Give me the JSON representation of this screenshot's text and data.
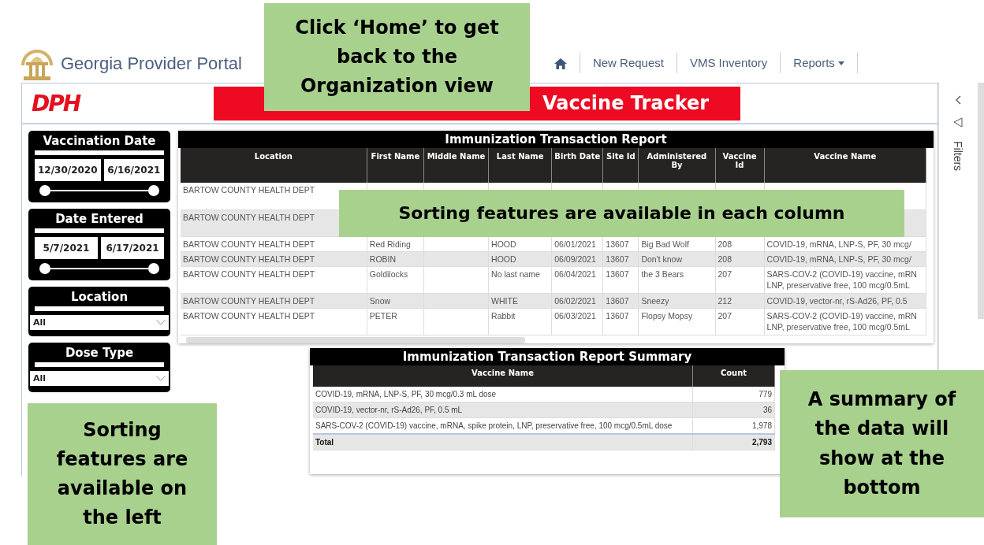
{
  "header": {
    "title": "Georgia Provider Portal",
    "nav": [
      {
        "kind": "home"
      },
      {
        "kind": "link",
        "label": "New Request"
      },
      {
        "kind": "link",
        "label": "VMS Inventory"
      },
      {
        "kind": "dropdown",
        "label": "Reports"
      }
    ]
  },
  "report": {
    "logo": "DPH",
    "banner_title": "Vaccine Tracker",
    "slicers": [
      {
        "kind": "date_range",
        "title": "Vaccination Date",
        "start": "12/30/2020",
        "end": "6/16/2021",
        "handles": [
          {
            "level": 0
          },
          {
            "level": 1
          }
        ]
      },
      {
        "kind": "date_range",
        "title": "Date Entered",
        "start": "5/7/2021",
        "end": "6/17/2021",
        "handles": [
          {
            "level": 0
          },
          {
            "level": 1
          }
        ]
      },
      {
        "kind": "dropdown",
        "title": "Location",
        "value": "All"
      },
      {
        "kind": "dropdown",
        "title": "Dose Type",
        "value": "All"
      }
    ],
    "table": {
      "title": "Immunization Transaction Report",
      "columns": [
        "Location",
        "First Name",
        "Middle Name",
        "Last Name",
        "Birth Date",
        "Site Id",
        "Administered By",
        "Vaccine Id",
        "Vaccine Name"
      ],
      "rows": [
        {
          "cells": [
            "BARTOW COUNTY HEALTH DEPT",
            null,
            null,
            null,
            null,
            null,
            null,
            null,
            null
          ]
        },
        {
          "cells": [
            "BARTOW COUNTY HEALTH DEPT",
            null,
            null,
            null,
            null,
            null,
            null,
            null,
            null
          ]
        },
        {
          "cells": [
            "BARTOW COUNTY HEALTH DEPT",
            "Red Riding",
            null,
            "HOOD",
            "06/01/2021",
            "13607",
            "Big Bad Wolf",
            "208",
            "COVID-19, mRNA, LNP-S, PF, 30 mcg/"
          ]
        },
        {
          "cells": [
            "BARTOW COUNTY HEALTH DEPT",
            "ROBIN",
            null,
            "HOOD",
            "06/09/2021",
            "13607",
            "Don't know",
            "208",
            "COVID-19, mRNA, LNP-S, PF, 30 mcg/"
          ]
        },
        {
          "cells": [
            "BARTOW COUNTY HEALTH DEPT",
            "Goldilocks",
            null,
            "No last name",
            "06/04/2021",
            "13607",
            "the 3 Bears",
            "207",
            "SARS-COV-2 (COVID-19) vaccine, mRN\nLNP, preservative free, 100 mcg/0.5mL"
          ]
        },
        {
          "cells": [
            "BARTOW COUNTY HEALTH DEPT",
            "Snow",
            null,
            "WHITE",
            "06/02/2021",
            "13607",
            "Sneezy",
            "212",
            "COVID-19, vector-nr, rS-Ad26, PF, 0.5"
          ]
        },
        {
          "cells": [
            "BARTOW COUNTY HEALTH DEPT",
            "PETER",
            null,
            "Rabbit",
            "06/03/2021",
            "13607",
            "Flopsy Mopsy",
            "207",
            "SARS-COV-2 (COVID-19) vaccine, mRN\nLNP, preservative free, 100 mcg/0.5mL"
          ]
        }
      ]
    },
    "summary": {
      "title": "Immunization Transaction Report Summary",
      "columns": [
        "Vaccine Name",
        "Count"
      ],
      "rows": [
        {
          "name": "COVID-19, mRNA, LNP-S, PF, 30 mcg/0.3 mL dose",
          "count": "779"
        },
        {
          "name": "COVID-19, vector-nr, rS-Ad26, PF, 0.5 mL",
          "count": "36"
        },
        {
          "name": "SARS-COV-2 (COVID-19) vaccine, mRNA, spike protein, LNP, preservative free, 100 mcg/0.5mL dose",
          "count": "1,978"
        }
      ],
      "total": {
        "label": "Total",
        "count": "2,793"
      }
    },
    "filters_pane": {
      "label": "Filters"
    }
  },
  "callouts": [
    {
      "text": "Click ‘Home’ to get back to the Organization view"
    },
    {
      "text": "Sorting features are available in each column"
    },
    {
      "text": "Sorting features are available on the left"
    },
    {
      "text": "A summary of the data will show at the bottom"
    }
  ]
}
